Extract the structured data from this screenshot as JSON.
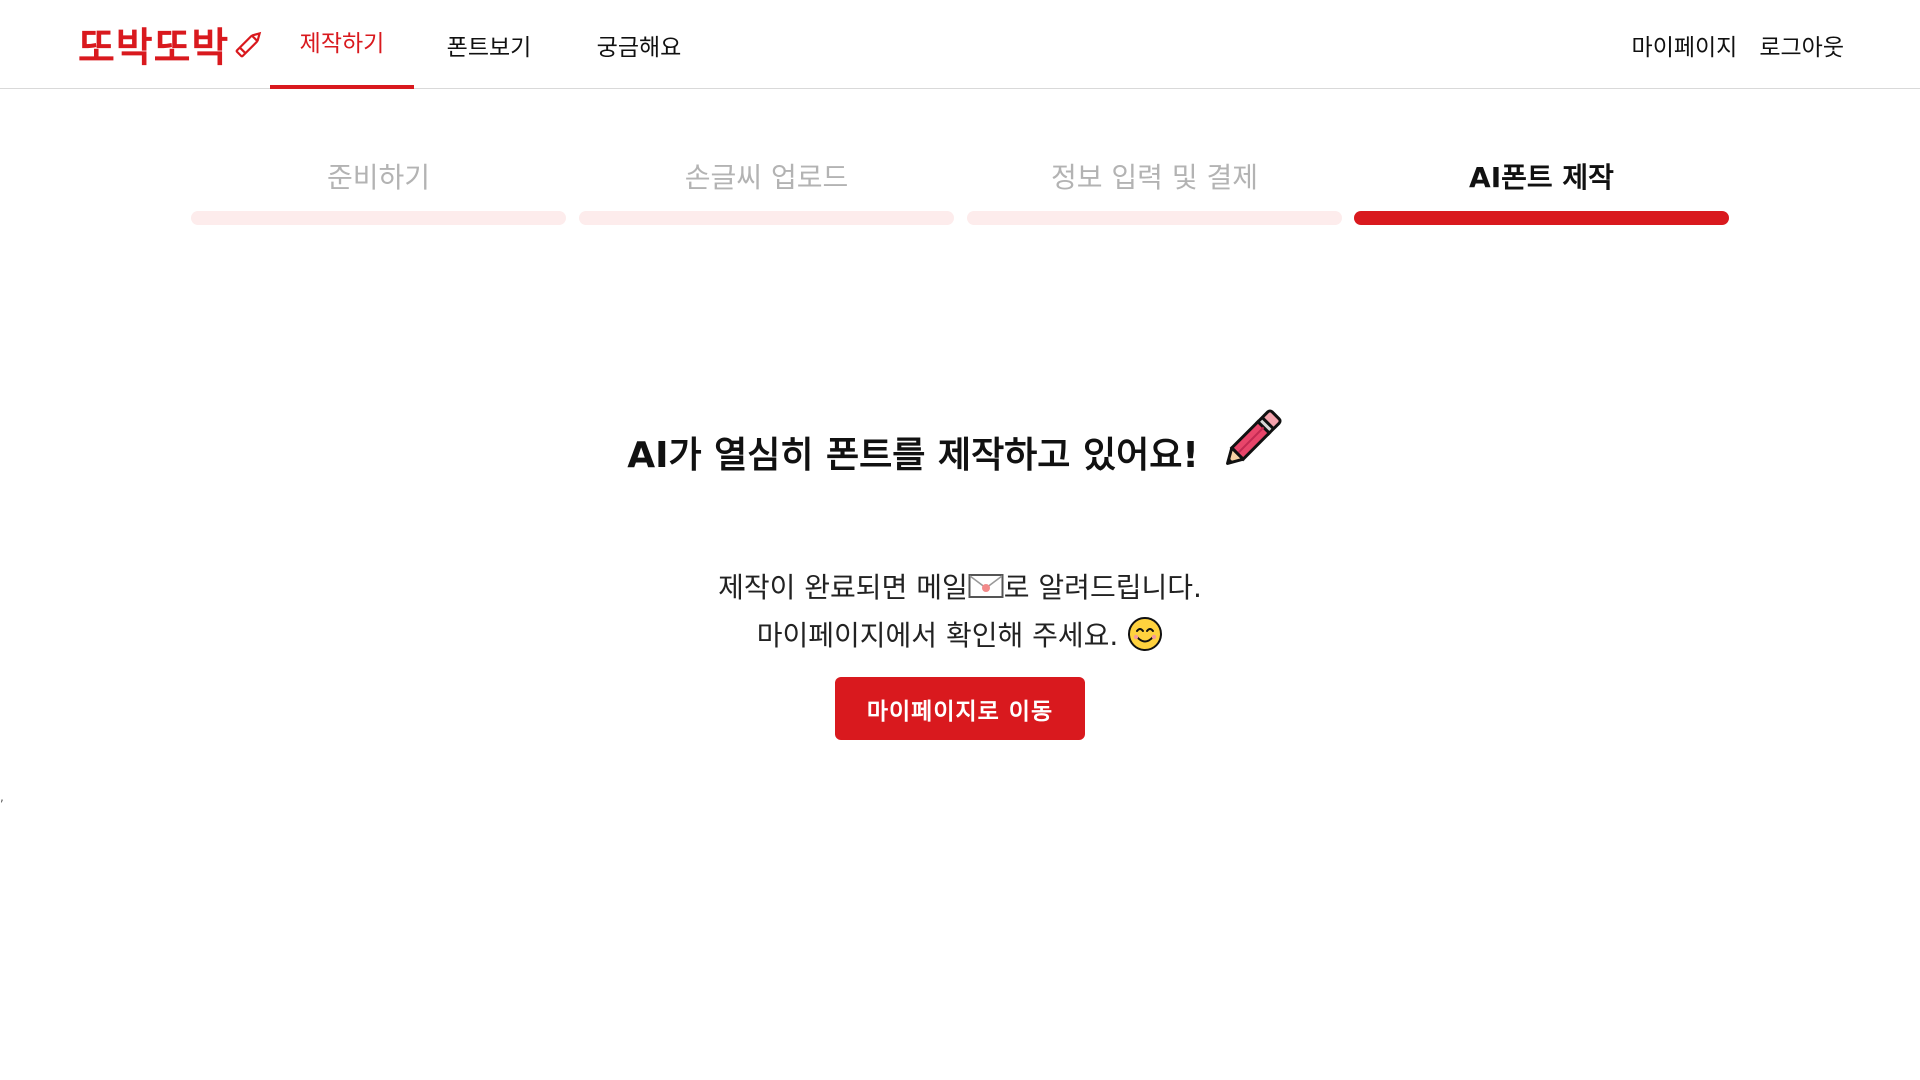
{
  "header": {
    "logo_text": "또박또박",
    "nav": [
      {
        "label": "제작하기"
      },
      {
        "label": "폰트보기"
      },
      {
        "label": "궁금해요"
      }
    ],
    "user_nav": {
      "mypage_label": "마이페이지",
      "logout_label": "로그아웃"
    }
  },
  "stepper": {
    "steps": [
      {
        "label": "준비하기"
      },
      {
        "label": "손글씨 업로드"
      },
      {
        "label": "정보 입력 및 결제"
      },
      {
        "label": "AI폰트 제작"
      }
    ],
    "current_step": 4
  },
  "main": {
    "title": "AI가 열심히 폰트를 제작하고 있어요!",
    "line1_before": "제작이 완료되면 메일",
    "line1_after": "로 알려드립니다.",
    "line2": "마이페이지에서 확인해 주세요.",
    "cta_label": "마이페이지로 이동"
  },
  "misc": {
    "stray_mark": ","
  },
  "colors": {
    "accent": "#d9191e",
    "inactive_bar": "#fdecec",
    "inactive_text": "#b3b3b3",
    "divider": "#d9d9d9"
  },
  "icons": {
    "logo": "pencil-icon",
    "title": "pencil-icon",
    "mail": "envelope-icon",
    "smile": "smiling-face-icon"
  }
}
